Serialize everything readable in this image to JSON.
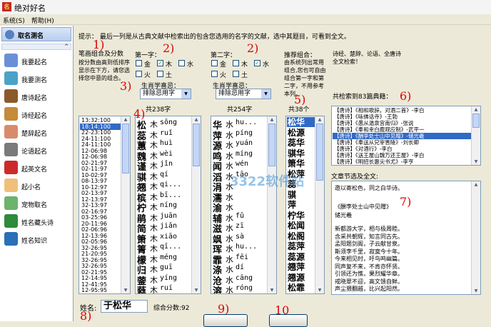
{
  "window": {
    "title": "绝对好名"
  },
  "menu": [
    {
      "label": "系统(S)"
    },
    {
      "label": "帮助(H)"
    }
  ],
  "sidebar": {
    "header": "取名测名",
    "items": [
      {
        "label": "我要起名",
        "icon": "person-icon",
        "color": "#6b8fd6"
      },
      {
        "label": "我要测名",
        "icon": "person-icon",
        "color": "#4aa3c7"
      },
      {
        "label": "唐诗起名",
        "icon": "tang-icon",
        "color": "#8b5a2b"
      },
      {
        "label": "诗经起名",
        "icon": "book-icon",
        "color": "#c58a3a"
      },
      {
        "label": "楚辞起名",
        "icon": "scroll-icon",
        "color": "#d88b6a"
      },
      {
        "label": "论语起名",
        "icon": "sage-icon",
        "color": "#7a7a7a"
      },
      {
        "label": "起英文名",
        "icon": "flag-icon",
        "color": "#cc2b2b"
      },
      {
        "label": "起小名",
        "icon": "baby-icon",
        "color": "#f0c07a"
      },
      {
        "label": "宠物取名",
        "icon": "pet-icon",
        "color": "#6cb36c"
      },
      {
        "label": "姓名藏头诗",
        "icon": "poem-icon",
        "color": "#2e8b3a"
      },
      {
        "label": "姓名知识",
        "icon": "globe-icon",
        "color": "#2a6fb8"
      }
    ]
  },
  "tip": "提示：   最后一列是从古典文献中检索出的包含您选用的名字的文献，选中其题目，可看到全文。",
  "scores": {
    "title": "笔画组合及分数",
    "desc": "按分数由高到低排序显示在下方，请您选择您中意的组合。",
    "items": [
      "13:32:100",
      "18:14:100",
      "22-23:100",
      "24-11:100",
      "24-11:100",
      "12-06:98",
      "12-06:98",
      "02-21:97",
      "02-11:97",
      "10-02:97",
      "08-13:97",
      "10-12:97",
      "02-13:97",
      "12-13:97",
      "32-13:97",
      "02-16:97",
      "03-25:96",
      "20-11:96",
      "02-06:96",
      "12-13:96",
      "02-05:96",
      "32-26:95",
      "21-20:95",
      "32-26:95",
      "32-26:95",
      "02-21:95",
      "12-14:95",
      "12-41:95",
      "12-95:95"
    ],
    "selected_index": 1
  },
  "char1": {
    "label": "第一字：",
    "elements": [
      {
        "name": "金",
        "checked": false
      },
      {
        "name": "木",
        "checked": true
      },
      {
        "name": "水",
        "checked": false
      },
      {
        "name": "火",
        "checked": false
      },
      {
        "name": "土",
        "checked": false
      }
    ],
    "fav_label": "生肖学喜忌：",
    "select_value": "排除忌用字",
    "count": "共238字",
    "list": [
      {
        "ch": "松",
        "el": "木",
        "py": "sōng"
      },
      {
        "ch": "蕊",
        "el": "木",
        "py": "ruǐ"
      },
      {
        "ch": "蕙",
        "el": "木",
        "py": "huì"
      },
      {
        "ch": "魏",
        "el": "木",
        "py": "wèi"
      },
      {
        "ch": "谨",
        "el": "木",
        "py": "jǐn"
      },
      {
        "ch": "骐",
        "el": "木",
        "py": "qí"
      },
      {
        "ch": "翘",
        "el": "木",
        "py": "qi..."
      },
      {
        "ch": "槟",
        "el": "木",
        "py": "bī..."
      },
      {
        "ch": "柠",
        "el": "木",
        "py": "níng"
      },
      {
        "ch": "鹃",
        "el": "木",
        "py": "juān"
      },
      {
        "ch": "简",
        "el": "木",
        "py": "jiǎn"
      },
      {
        "ch": "箫",
        "el": "木",
        "py": "xiāo"
      },
      {
        "ch": "箐",
        "el": "木",
        "py": "qī..."
      },
      {
        "ch": "檬",
        "el": "木",
        "py": "méng"
      },
      {
        "ch": "归",
        "el": "木",
        "py": "guī"
      },
      {
        "ch": "蓥",
        "el": "木",
        "py": "yíng"
      },
      {
        "ch": "蕤",
        "el": "木",
        "py": "ruí"
      }
    ]
  },
  "char2": {
    "label": "第二字：",
    "elements": [
      {
        "name": "金",
        "checked": false
      },
      {
        "name": "木",
        "checked": false
      },
      {
        "name": "水",
        "checked": true
      },
      {
        "name": "火",
        "checked": false
      },
      {
        "name": "土",
        "checked": false
      }
    ],
    "fav_label": "生肖学喜忌：",
    "select_value": "排除忌用字",
    "count": "共254字",
    "list": [
      {
        "ch": "华",
        "el": "水",
        "py": "hu..."
      },
      {
        "ch": "萍",
        "el": "水",
        "py": "píng"
      },
      {
        "ch": "源",
        "el": "水",
        "py": "yuán"
      },
      {
        "ch": "鸣",
        "el": "水",
        "py": "míng"
      },
      {
        "ch": "闻",
        "el": "水",
        "py": "wén"
      },
      {
        "ch": "滔",
        "el": "水",
        "py": "tāo"
      },
      {
        "ch": "涓",
        "el": "水",
        "py": ""
      },
      {
        "ch": "濡",
        "el": "水",
        "py": ""
      },
      {
        "ch": "渝",
        "el": "水",
        "py": ""
      },
      {
        "ch": "辅",
        "el": "水",
        "py": "fǔ"
      },
      {
        "ch": "滋",
        "el": "水",
        "py": "zī"
      },
      {
        "ch": "飒",
        "el": "水",
        "py": "sà"
      },
      {
        "ch": "珲",
        "el": "水",
        "py": "hu..."
      },
      {
        "ch": "霏",
        "el": "水",
        "py": "fēi"
      },
      {
        "ch": "涤",
        "el": "水",
        "py": "dí"
      },
      {
        "ch": "沧",
        "el": "水",
        "py": "cāng"
      },
      {
        "ch": "溶",
        "el": "水",
        "py": "róng"
      }
    ]
  },
  "combos": {
    "title": "推荐组合：",
    "desc": "由系统列出常用组合,您也可自由组合第一字和第二字，不用参考本列。",
    "count": "共38个",
    "items": [
      "松华",
      "松源",
      "蕊华",
      "骐华",
      "箫华",
      "松萍",
      "蕊",
      "骐",
      "萍",
      "柠华",
      "松闻",
      "松阁",
      "蕊萍",
      "蕊源",
      "翘萍",
      "翘源",
      "松霏"
    ],
    "selected_index": 0
  },
  "classics": {
    "title": "诗经、楚辞、论语、全唐诗全文检索！",
    "count_text": "共检索到83篇典籍：",
    "items": [
      "【唐诗】《相和歌辞。对酒二首》-李白",
      "【唐诗】《咏佛话寺》-王勃",
      "【唐诗】《愚从温泉宫南归》-张说",
      "【唐诗】《奉和幸白鹿观应制》-武平一",
      "【唐诗】《酬李处士山中见赠》-储光羲",
      "【唐诗】《奉送从兄宰晋陵》-刘长卿",
      "【唐诗】《对酒行》-李白",
      "【唐诗】《送王屋山魏万还王屋》-李白",
      "【唐诗】《明招长惠尖书尤》-李亨"
    ],
    "selected_index": 4
  },
  "excerpt": {
    "title": "文章节选及全文:",
    "top": "邀以寄松色，同之白华诗。",
    "poem_title": "《酬李处士山中见赠》",
    "author": "储光羲",
    "body": [
      "新都游大学，相与极周睦。",
      "含采共朝辉，知言同古先。",
      "孟阳题剑阁，子云献甘泉。",
      "斯须李千里，寂寞今十年。",
      "今来相见时，吁鸟鸣幽篇。",
      "同声复不来，不肯亦怀贤。",
      "引领还为憔，果烈耀华章。",
      "戒晓翠不迎，高文馈自鲜。",
      "声尘猥翻越，比兴起阳然。"
    ]
  },
  "bottom": {
    "name_label": "姓名:",
    "name_value": "于松华",
    "score_text": "综合分数:92"
  },
  "annotations": [
    "1)",
    "2)",
    "2)",
    "3)",
    "4)",
    "5)",
    "6)",
    "7)",
    "8)",
    "9)",
    "10"
  ],
  "watermark": "3322软件站"
}
